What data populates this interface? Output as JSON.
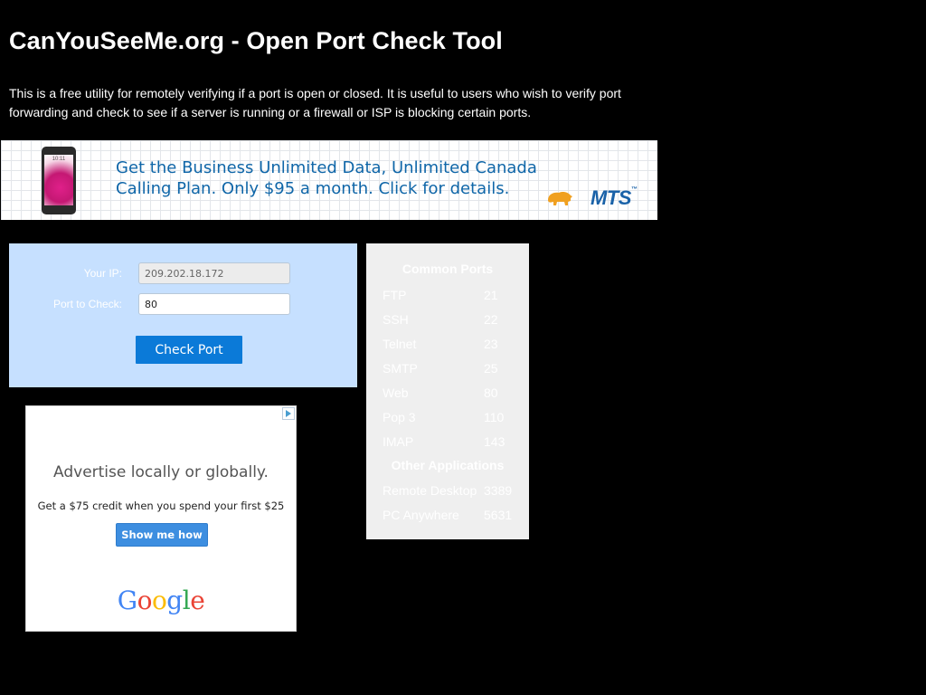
{
  "page": {
    "title": "CanYouSeeMe.org - Open Port Check Tool",
    "intro": "This is a free utility for remotely verifying if a port is open or closed. It is useful to users who wish to verify port forwarding and check to see if a server is running or a firewall or ISP is blocking certain ports."
  },
  "banner_ad": {
    "line1": "Get the Business Unlimited Data, Unlimited Canada",
    "line2": "Calling Plan. Only $95 a month. Click for details.",
    "brand": "MTS",
    "accent": "#0f66a8",
    "icons": [
      "phone-image",
      "bison-logo"
    ]
  },
  "form": {
    "ip_label": "Your IP:",
    "ip_value": "209.202.18.172",
    "port_label": "Port to Check:",
    "port_value": "80",
    "button_label": "Check Port",
    "panel_color": "#c6e0ff",
    "button_color": "#0b7ad8"
  },
  "common_ports": {
    "heading": "Common Ports",
    "items": [
      {
        "name": "FTP",
        "port": "21"
      },
      {
        "name": "SSH",
        "port": "22"
      },
      {
        "name": "Telnet",
        "port": "23"
      },
      {
        "name": "SMTP",
        "port": "25"
      },
      {
        "name": "Web",
        "port": "80"
      },
      {
        "name": "Pop 3",
        "port": "110"
      },
      {
        "name": "IMAP",
        "port": "143"
      }
    ],
    "other_heading": "Other Applications",
    "other_items": [
      {
        "name": "Remote Desktop",
        "port": "3389"
      },
      {
        "name": "PC Anywhere",
        "port": "5631"
      }
    ]
  },
  "google_ad": {
    "headline": "Advertise locally or globally.",
    "sub": "Get a $75 credit when you spend your first $25",
    "cta": "Show me how",
    "logo": "Google",
    "icons": [
      "adchoices-icon"
    ]
  }
}
